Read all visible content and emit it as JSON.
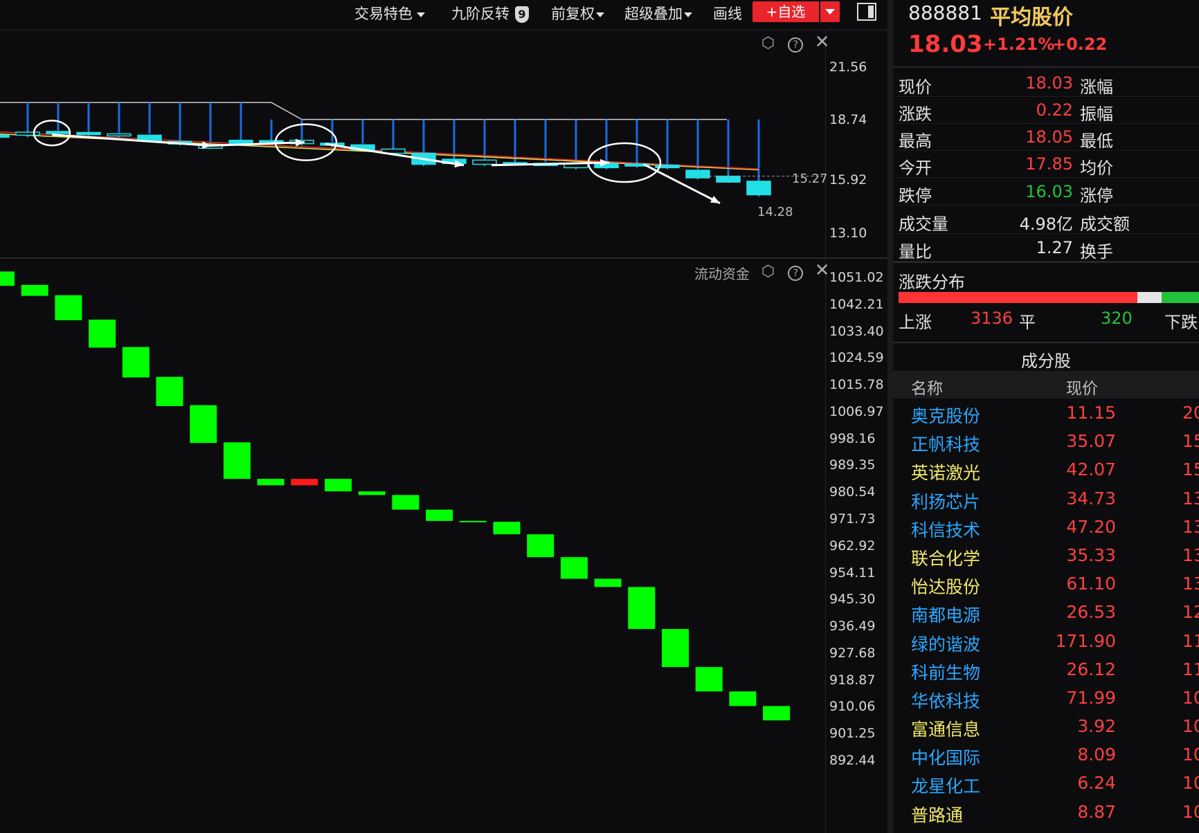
{
  "toolbar": {
    "trade_feature": "交易特色",
    "nine_reversal": "九阶反转",
    "nine_badge": "9",
    "adjust": "前复权",
    "overlay": "超级叠加",
    "draw": "画线",
    "add_watch": "+自选"
  },
  "top_chart": {
    "axis_labels": [
      "21.56",
      "18.74",
      "15.92",
      "13.10"
    ],
    "annotations": [
      "15.27",
      "14.28"
    ],
    "colors": {
      "bull": "#ff3b3b",
      "bear": "#22dfe8",
      "volume": "#1a6be0",
      "ma_yellow": "#e8e04a",
      "ma_red": "#d83030",
      "annotation": "#ffffff"
    }
  },
  "flow_chart": {
    "label": "流动资金",
    "axis_labels": [
      "1051.02",
      "1042.21",
      "1033.40",
      "1024.59",
      "1015.78",
      "1006.97",
      "998.16",
      "989.35",
      "980.54",
      "971.73",
      "962.92",
      "954.11",
      "945.30",
      "936.49",
      "927.68",
      "918.87",
      "910.06",
      "901.25",
      "892.44"
    ],
    "colors": {
      "down": "#00ff00",
      "up": "#ff1a1a"
    }
  },
  "chart_data": [
    {
      "type": "candlestick",
      "yaxis_ticks": [
        21.56,
        18.74,
        15.92,
        13.1
      ],
      "ylim": [
        12.2,
        22.5
      ],
      "annotations": [
        15.27,
        14.28
      ],
      "candles": [
        {
          "o": 17.62,
          "c": 17.55,
          "h": 17.7,
          "l": 17.4,
          "bull": false
        },
        {
          "o": 17.8,
          "c": 17.62,
          "h": 17.9,
          "l": 17.5,
          "bull": false
        },
        {
          "o": 17.84,
          "c": 17.78,
          "h": 17.9,
          "l": 17.7,
          "bull": false
        },
        {
          "o": 17.78,
          "c": 17.7,
          "h": 17.85,
          "l": 17.6,
          "bull": false
        },
        {
          "o": 17.7,
          "c": 17.6,
          "h": 17.75,
          "l": 17.5,
          "bull": false
        },
        {
          "o": 17.62,
          "c": 17.3,
          "h": 17.65,
          "l": 17.2,
          "bull": false
        },
        {
          "o": 17.25,
          "c": 17.1,
          "h": 17.3,
          "l": 17.0,
          "bull": false
        },
        {
          "o": 17.05,
          "c": 16.85,
          "h": 17.1,
          "l": 16.8,
          "bull": false
        },
        {
          "o": 17.32,
          "c": 17.1,
          "h": 17.4,
          "l": 17.0,
          "bull": false
        },
        {
          "o": 17.3,
          "c": 17.2,
          "h": 17.4,
          "l": 17.1,
          "bull": false
        },
        {
          "o": 17.32,
          "c": 17.12,
          "h": 17.4,
          "l": 17.0,
          "bull": false
        },
        {
          "o": 17.15,
          "c": 17.05,
          "h": 17.2,
          "l": 16.9,
          "bull": false
        },
        {
          "o": 17.05,
          "c": 16.75,
          "h": 17.1,
          "l": 16.7,
          "bull": false
        },
        {
          "o": 16.8,
          "c": 16.55,
          "h": 16.9,
          "l": 16.5,
          "bull": false
        },
        {
          "o": 16.55,
          "c": 15.9,
          "h": 16.6,
          "l": 15.8,
          "bull": false
        },
        {
          "o": 16.2,
          "c": 15.95,
          "h": 16.3,
          "l": 15.9,
          "bull": false
        },
        {
          "o": 16.15,
          "c": 15.9,
          "h": 16.2,
          "l": 15.8,
          "bull": false
        },
        {
          "o": 16.0,
          "c": 15.9,
          "h": 16.1,
          "l": 15.85,
          "bull": false
        },
        {
          "o": 15.95,
          "c": 15.85,
          "h": 16.0,
          "l": 15.8,
          "bull": false
        },
        {
          "o": 15.95,
          "c": 15.7,
          "h": 16.0,
          "l": 15.6,
          "bull": false
        },
        {
          "o": 15.95,
          "c": 15.7,
          "h": 16.0,
          "l": 15.6,
          "bull": false
        },
        {
          "o": 15.92,
          "c": 15.82,
          "h": 16.0,
          "l": 15.7,
          "bull": false
        },
        {
          "o": 15.85,
          "c": 15.7,
          "h": 15.9,
          "l": 15.6,
          "bull": false
        },
        {
          "o": 15.55,
          "c": 15.1,
          "h": 15.6,
          "l": 15.0,
          "bull": false
        },
        {
          "o": 15.2,
          "c": 14.85,
          "h": 15.3,
          "l": 14.8,
          "bull": false
        },
        {
          "o": 14.9,
          "c": 14.1,
          "h": 15.0,
          "l": 14.0,
          "bull": false
        }
      ]
    },
    {
      "type": "bar",
      "name": "流动资金",
      "yaxis_ticks": [
        1051.02,
        1042.21,
        1033.4,
        1024.59,
        1015.78,
        1006.97,
        998.16,
        989.35,
        980.54,
        971.73,
        962.92,
        954.11,
        945.3,
        936.49,
        927.68,
        918.87,
        910.06,
        901.25,
        892.44
      ],
      "bars": [
        {
          "top": 1053.2,
          "bottom": 1048.5,
          "dir": "down"
        },
        {
          "top": 1048.8,
          "bottom": 1045.2,
          "dir": "down"
        },
        {
          "top": 1045.4,
          "bottom": 1037.2,
          "dir": "down"
        },
        {
          "top": 1037.4,
          "bottom": 1028.2,
          "dir": "down"
        },
        {
          "top": 1028.4,
          "bottom": 1018.4,
          "dir": "down"
        },
        {
          "top": 1018.6,
          "bottom": 1009.0,
          "dir": "down"
        },
        {
          "top": 1009.3,
          "bottom": 996.9,
          "dir": "down"
        },
        {
          "top": 997.1,
          "bottom": 985.1,
          "dir": "down"
        },
        {
          "top": 985.1,
          "bottom": 983.0,
          "dir": "down"
        },
        {
          "top": 985.1,
          "bottom": 983.0,
          "dir": "up"
        },
        {
          "top": 985.1,
          "bottom": 981.0,
          "dir": "down"
        },
        {
          "top": 981.0,
          "bottom": 979.8,
          "dir": "down"
        },
        {
          "top": 979.8,
          "bottom": 975.0,
          "dir": "down"
        },
        {
          "top": 975.0,
          "bottom": 971.3,
          "dir": "down"
        },
        {
          "top": 971.3,
          "bottom": 971.0,
          "dir": "down"
        },
        {
          "top": 971.0,
          "bottom": 966.9,
          "dir": "down"
        },
        {
          "top": 966.9,
          "bottom": 959.4,
          "dir": "down"
        },
        {
          "top": 959.4,
          "bottom": 952.3,
          "dir": "down"
        },
        {
          "top": 952.3,
          "bottom": 949.6,
          "dir": "down"
        },
        {
          "top": 949.6,
          "bottom": 935.8,
          "dir": "down"
        },
        {
          "top": 935.8,
          "bottom": 923.3,
          "dir": "down"
        },
        {
          "top": 923.3,
          "bottom": 915.3,
          "dir": "down"
        },
        {
          "top": 915.3,
          "bottom": 910.5,
          "dir": "down"
        },
        {
          "top": 910.5,
          "bottom": 905.8,
          "dir": "down"
        }
      ]
    }
  ],
  "quote": {
    "code": "888881",
    "name": "平均股价",
    "price": "18.03",
    "pct": "+1.21%",
    "chg": "+0.22",
    "rows": [
      {
        "label": "现价",
        "value": "18.03",
        "color": "#ff4040",
        "label2": "涨幅"
      },
      {
        "label": "涨跌",
        "value": "0.22",
        "color": "#ff4040",
        "label2": "振幅"
      },
      {
        "label": "最高",
        "value": "18.05",
        "color": "#ff4040",
        "label2": "最低"
      },
      {
        "label": "今开",
        "value": "17.85",
        "color": "#ff4040",
        "label2": "均价"
      },
      {
        "label": "跌停",
        "value": "16.03",
        "color": "#22c23a",
        "label2": "涨停"
      },
      {
        "label": "成交量",
        "value": "4.98亿",
        "color": "#e2e2e2",
        "label2": "成交额"
      },
      {
        "label": "量比",
        "value": "1.27",
        "color": "#e2e2e2",
        "label2": "换手"
      }
    ]
  },
  "distribution": {
    "title": "涨跌分布",
    "up_label": "上涨",
    "up_count": "3136",
    "flat_label": "平",
    "flat_count": "320",
    "down_label": "下跌",
    "up_fraction": 0.795,
    "flat_fraction": 0.081,
    "down_fraction": 0.124,
    "colors": {
      "up": "#ff3535",
      "flat": "#e6e6e6",
      "down": "#22c23a"
    }
  },
  "components": {
    "title": "成分股",
    "col_name": "名称",
    "col_price": "现价",
    "rows": [
      {
        "name": "奥克股份",
        "price": "11.15",
        "pct": "20",
        "color": "#2aa8ff"
      },
      {
        "name": "正帆科技",
        "price": "35.07",
        "pct": "15",
        "color": "#2aa8ff"
      },
      {
        "name": "英诺激光",
        "price": "42.07",
        "pct": "15",
        "color": "#f2e86a"
      },
      {
        "name": "利扬芯片",
        "price": "34.73",
        "pct": "13",
        "color": "#2aa8ff"
      },
      {
        "name": "科信技术",
        "price": "47.20",
        "pct": "13",
        "color": "#2aa8ff"
      },
      {
        "name": "联合化学",
        "price": "35.33",
        "pct": "13",
        "color": "#f2e86a"
      },
      {
        "name": "怡达股份",
        "price": "61.10",
        "pct": "13",
        "color": "#f2e86a"
      },
      {
        "name": "南都电源",
        "price": "26.53",
        "pct": "12",
        "color": "#2aa8ff"
      },
      {
        "name": "绿的谐波",
        "price": "171.90",
        "pct": "11",
        "color": "#2aa8ff"
      },
      {
        "name": "科前生物",
        "price": "26.12",
        "pct": "11",
        "color": "#2aa8ff"
      },
      {
        "name": "华依科技",
        "price": "71.99",
        "pct": "10",
        "color": "#2aa8ff"
      },
      {
        "name": "富通信息",
        "price": "3.92",
        "pct": "10",
        "color": "#f2e86a"
      },
      {
        "name": "中化国际",
        "price": "8.09",
        "pct": "10",
        "color": "#2aa8ff"
      },
      {
        "name": "龙星化工",
        "price": "6.24",
        "pct": "10",
        "color": "#2aa8ff"
      },
      {
        "name": "普路通",
        "price": "8.87",
        "pct": "10",
        "color": "#f2e86a"
      }
    ]
  }
}
